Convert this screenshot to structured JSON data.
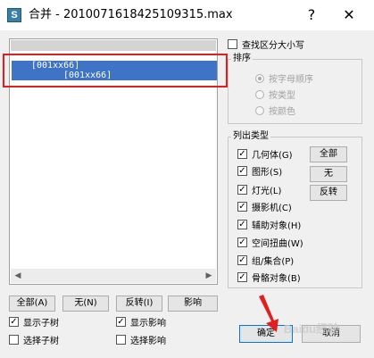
{
  "window": {
    "app_icon_letter": "S",
    "title": "合并 - 2010071618425109315.max",
    "help_glyph": "?",
    "close_glyph": "✕"
  },
  "list": {
    "items": [
      "[001xx66]",
      "[001xx66]"
    ]
  },
  "list_buttons": {
    "all": "全部(A)",
    "none": "无(N)",
    "invert": "反转(I)",
    "influence": "影响"
  },
  "bottom_checks": {
    "show_subtree": {
      "label": "显示子树",
      "checked": true
    },
    "show_influence": {
      "label": "显示影响",
      "checked": true
    },
    "select_subtree": {
      "label": "选择子树",
      "checked": false
    },
    "select_influence": {
      "label": "选择影响",
      "checked": false
    }
  },
  "case_sensitive": {
    "label": "查找区分大小写",
    "checked": false
  },
  "sort": {
    "title": "排序",
    "options": [
      {
        "label": "按字母顺序",
        "selected": true
      },
      {
        "label": "按类型",
        "selected": false
      },
      {
        "label": "按颜色",
        "selected": false
      }
    ]
  },
  "list_types": {
    "title": "列出类型",
    "items": [
      {
        "label": "几何体(G)",
        "checked": true
      },
      {
        "label": "图形(S)",
        "checked": true
      },
      {
        "label": "灯光(L)",
        "checked": true
      },
      {
        "label": "摄影机(C)",
        "checked": true
      },
      {
        "label": "辅助对象(H)",
        "checked": true
      },
      {
        "label": "空间扭曲(W)",
        "checked": true
      },
      {
        "label": "组/集合(P)",
        "checked": true
      },
      {
        "label": "骨骼对象(B)",
        "checked": true
      }
    ],
    "all_button": "全部",
    "none_button": "无",
    "invert_button": "反转"
  },
  "dialog_buttons": {
    "ok": "确定",
    "cancel": "取消"
  },
  "watermark": "Baidu经验",
  "colors": {
    "selection": "#3f73c6",
    "annotation": "#e02020"
  }
}
